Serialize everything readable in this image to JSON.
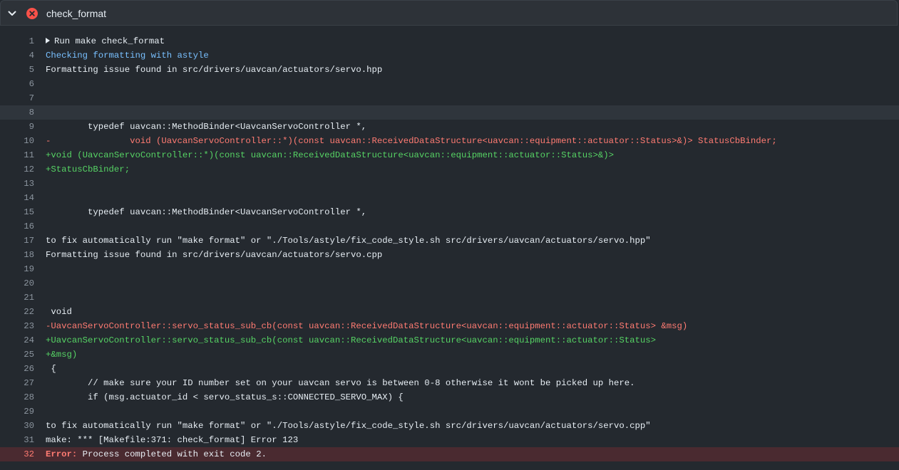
{
  "job": {
    "title": "check_format",
    "status": "failed",
    "status_color": "#f85149"
  },
  "log_lines": [
    {
      "num": "1",
      "text": "Run make check_format",
      "style": "group"
    },
    {
      "num": "4",
      "text": "Checking formatting with astyle",
      "style": "blue"
    },
    {
      "num": "5",
      "text": "Formatting issue found in src/drivers/uavcan/actuators/servo.hpp",
      "style": "plain"
    },
    {
      "num": "6",
      "text": "",
      "style": "plain"
    },
    {
      "num": "7",
      "text": "",
      "style": "plain"
    },
    {
      "num": "8",
      "text": "",
      "style": "plain",
      "selected": true
    },
    {
      "num": "9",
      "text": "        typedef uavcan::MethodBinder<UavcanServoController *,",
      "style": "plain"
    },
    {
      "num": "10",
      "text": "-               void (UavcanServoController::*)(const uavcan::ReceivedDataStructure<uavcan::equipment::actuator::Status>&)> StatusCbBinder;",
      "style": "red"
    },
    {
      "num": "11",
      "text": "+void (UavcanServoController::*)(const uavcan::ReceivedDataStructure<uavcan::equipment::actuator::Status>&)>",
      "style": "green"
    },
    {
      "num": "12",
      "text": "+StatusCbBinder;",
      "style": "green"
    },
    {
      "num": "13",
      "text": "",
      "style": "plain"
    },
    {
      "num": "14",
      "text": "",
      "style": "plain"
    },
    {
      "num": "15",
      "text": "        typedef uavcan::MethodBinder<UavcanServoController *,",
      "style": "plain"
    },
    {
      "num": "16",
      "text": "",
      "style": "plain"
    },
    {
      "num": "17",
      "text": "to fix automatically run \"make format\" or \"./Tools/astyle/fix_code_style.sh src/drivers/uavcan/actuators/servo.hpp\"",
      "style": "plain"
    },
    {
      "num": "18",
      "text": "Formatting issue found in src/drivers/uavcan/actuators/servo.cpp",
      "style": "plain"
    },
    {
      "num": "19",
      "text": "",
      "style": "plain"
    },
    {
      "num": "20",
      "text": "",
      "style": "plain"
    },
    {
      "num": "21",
      "text": "",
      "style": "plain"
    },
    {
      "num": "22",
      "text": " void",
      "style": "plain"
    },
    {
      "num": "23",
      "text": "-UavcanServoController::servo_status_sub_cb(const uavcan::ReceivedDataStructure<uavcan::equipment::actuator::Status> &msg)",
      "style": "red"
    },
    {
      "num": "24",
      "text": "+UavcanServoController::servo_status_sub_cb(const uavcan::ReceivedDataStructure<uavcan::equipment::actuator::Status>",
      "style": "green"
    },
    {
      "num": "25",
      "text": "+&msg)",
      "style": "green"
    },
    {
      "num": "26",
      "text": " {",
      "style": "plain"
    },
    {
      "num": "27",
      "text": "        // make sure your ID number set on your uavcan servo is between 0-8 otherwise it wont be picked up here.",
      "style": "plain"
    },
    {
      "num": "28",
      "text": "        if (msg.actuator_id < servo_status_s::CONNECTED_SERVO_MAX) {",
      "style": "plain"
    },
    {
      "num": "29",
      "text": "",
      "style": "plain"
    },
    {
      "num": "30",
      "text": "to fix automatically run \"make format\" or \"./Tools/astyle/fix_code_style.sh src/drivers/uavcan/actuators/servo.cpp\"",
      "style": "plain"
    },
    {
      "num": "31",
      "text": "make: *** [Makefile:371: check_format] Error 123",
      "style": "plain"
    },
    {
      "num": "32",
      "text": "Process completed with exit code 2.",
      "style": "error",
      "label": "Error:"
    }
  ],
  "colors": {
    "background": "#24292f",
    "header_bg": "#2d3238",
    "text": "#e6edf3",
    "line_number": "#8b949e",
    "info_blue": "#79c0ff",
    "removed_red": "#ff7b72",
    "added_green": "#56d364",
    "error_row_bg": "#4a2a30",
    "selected_row_bg": "#2f353c"
  },
  "icons": {
    "collapse": "chevron-down-icon",
    "status": "x-circle-icon",
    "group": "triangle-right-icon"
  }
}
